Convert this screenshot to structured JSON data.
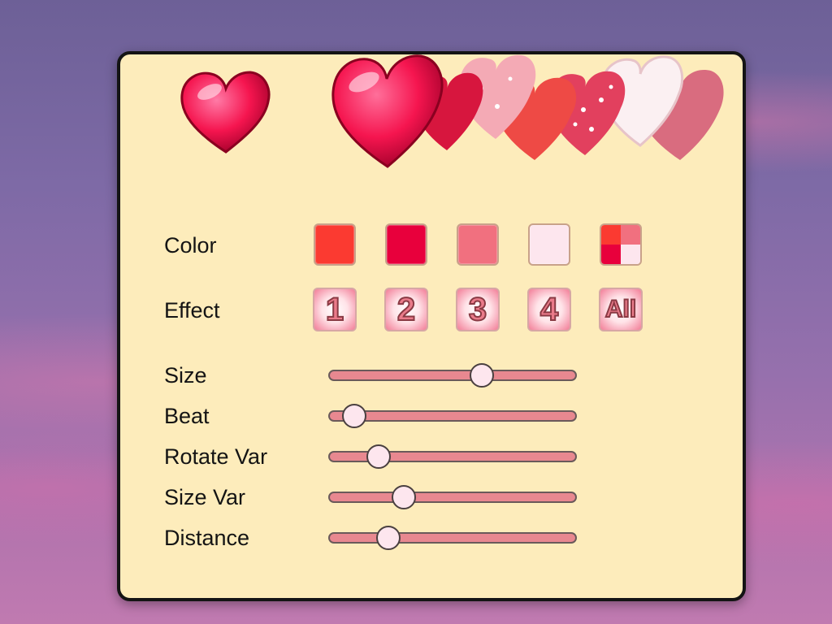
{
  "settings": {
    "color_label": "Color",
    "effect_label": "Effect",
    "color_swatches": [
      {
        "name": "red",
        "color": "#fb3a31"
      },
      {
        "name": "crimson",
        "color": "#e8003c"
      },
      {
        "name": "pink",
        "color": "#f1707f"
      },
      {
        "name": "pale-pink",
        "color": "#fde6ee"
      },
      {
        "name": "multi",
        "colors": [
          "#fb3a31",
          "#f1707f",
          "#e8003c",
          "#fde6ee"
        ]
      }
    ],
    "effects": [
      {
        "label": "1"
      },
      {
        "label": "2"
      },
      {
        "label": "3"
      },
      {
        "label": "4"
      },
      {
        "label": "All"
      }
    ],
    "sliders": [
      {
        "label": "Size",
        "value": 0.62
      },
      {
        "label": "Beat",
        "value": 0.1
      },
      {
        "label": "Rotate Var",
        "value": 0.2
      },
      {
        "label": "Size Var",
        "value": 0.3
      },
      {
        "label": "Distance",
        "value": 0.24
      }
    ]
  }
}
